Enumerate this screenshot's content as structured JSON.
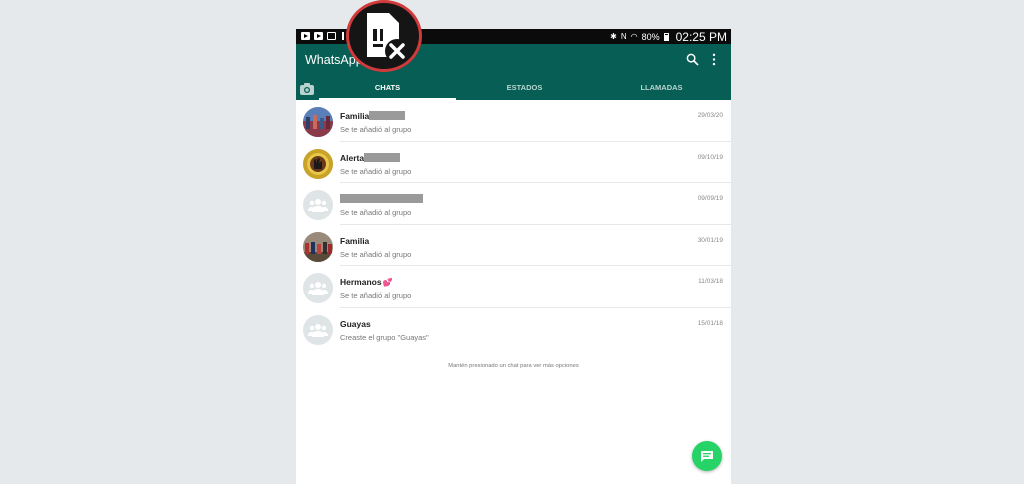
{
  "status_bar": {
    "battery": "80%",
    "time": "02:25 PM",
    "left_icons": [
      "youtube-icon",
      "youtube-icon",
      "image-icon",
      "upload-icon"
    ],
    "right_icons": [
      "bluetooth-icon",
      "nfc-icon",
      "no-sim-icon",
      "wifi-icon",
      "battery-icon"
    ]
  },
  "app": {
    "title": "WhatsApp",
    "accent_color": "#075e54",
    "fab_color": "#25d366"
  },
  "tabs": [
    {
      "label": "CHATS",
      "active": true
    },
    {
      "label": "ESTADOS",
      "active": false
    },
    {
      "label": "LLAMADAS",
      "active": false
    }
  ],
  "chats": [
    {
      "name": "Familia",
      "message": "Se te añadió al grupo",
      "date": "29/03/20"
    },
    {
      "name": "Alerta",
      "message": "Se te añadió al grupo",
      "date": "09/10/19"
    },
    {
      "name": "",
      "message": "Se te añadió al grupo",
      "date": "09/09/19"
    },
    {
      "name": "Familia",
      "message": "Se te añadió al grupo",
      "date": "30/01/19"
    },
    {
      "name": "Hermanos",
      "message": "Se te añadió al grupo",
      "date": "11/03/18"
    },
    {
      "name": "Guayas",
      "message": "Creaste el grupo \"Guayas\"",
      "date": "15/01/18"
    }
  ],
  "hint": "Mantén presionado un chat para ver más opciones"
}
